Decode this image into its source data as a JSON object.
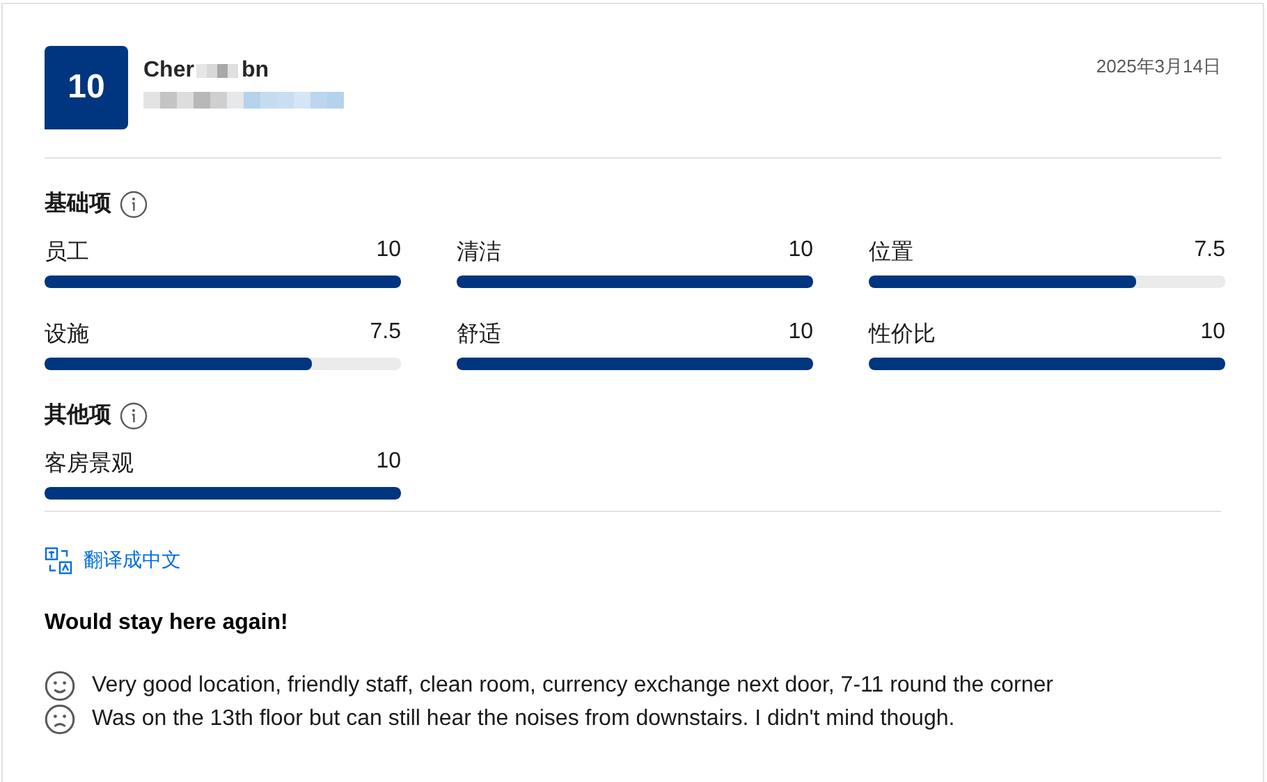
{
  "review": {
    "score": "10",
    "reviewer": {
      "name_start": "Cher",
      "name_end": "bn"
    },
    "date": "2025年3月14日",
    "sections": [
      {
        "title": "基础项",
        "items": [
          {
            "label": "员工",
            "reading": "10",
            "level": 1
          },
          {
            "label": "清洁",
            "reading": "10",
            "level": 1
          },
          {
            "label": "位置",
            "reading": "7.5",
            "level": 0.75
          },
          {
            "label": "设施",
            "reading": "7.5",
            "level": 0.75
          },
          {
            "label": "舒适",
            "reading": "10",
            "level": 1
          },
          {
            "label": "性价比",
            "reading": "10",
            "level": 1
          }
        ]
      },
      {
        "title": "其他项",
        "items": [
          {
            "label": "客房景观",
            "reading": "10",
            "level": 1
          }
        ]
      }
    ],
    "translate_link": "翻译成中文",
    "title": "Would stay here again!",
    "comments": [
      {
        "kind": "positive",
        "text": "Very good location, friendly staff, clean room, currency exchange next door, 7-11 round the corner"
      },
      {
        "kind": "negative",
        "text": "Was on the 13th floor but can still hear the noises from downstairs. I didn't mind though."
      }
    ]
  }
}
